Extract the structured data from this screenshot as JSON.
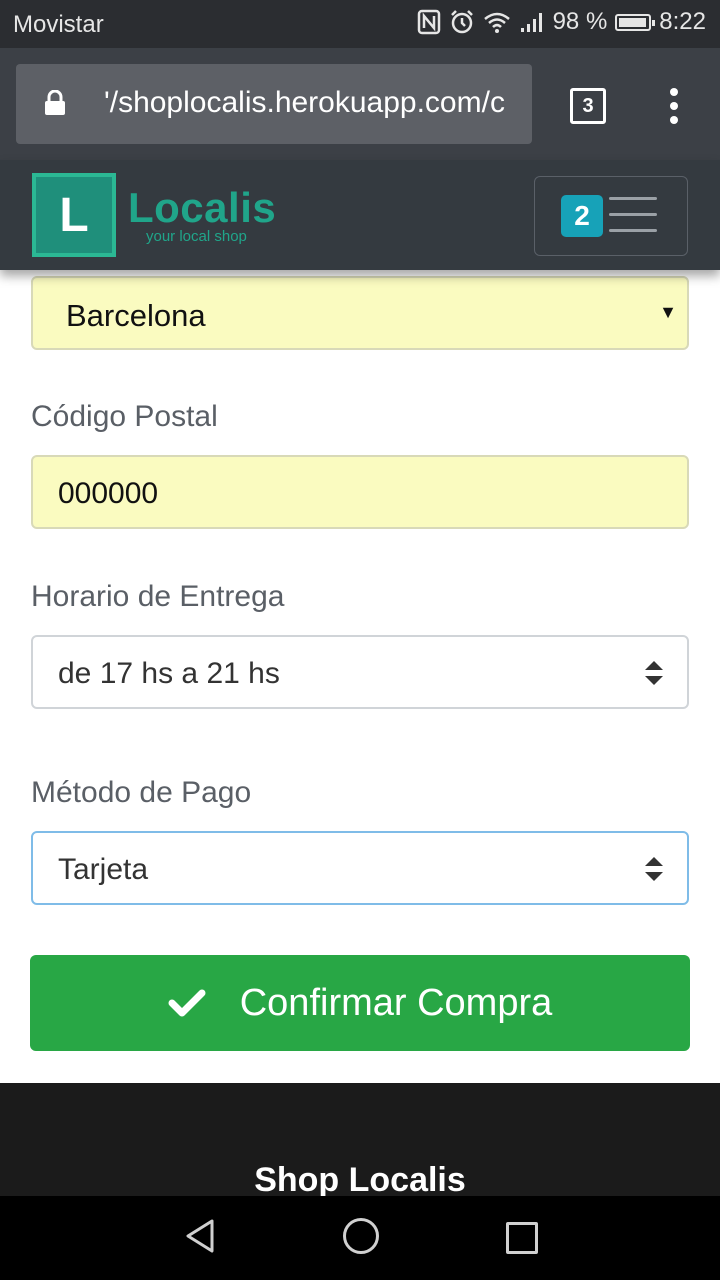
{
  "status_bar": {
    "carrier": "Movistar",
    "battery_text": "98 %",
    "time": "8:22",
    "battery_level": 0.98,
    "icons": [
      "nfc-icon",
      "alarm-icon",
      "wifi-icon",
      "signal-icon",
      "battery-icon"
    ]
  },
  "browser": {
    "url": "'/shoplocalis.herokuapp.com/c",
    "tab_count": "3"
  },
  "navbar": {
    "logo_letter": "L",
    "brand_name": "Localis",
    "tagline": "your local shop",
    "cart_count": "2"
  },
  "form": {
    "city_value": "Barcelona",
    "postal_label": "Código Postal",
    "postal_value": "000000",
    "schedule_label": "Horario de Entrega",
    "schedule_value": "de 17 hs a 21 hs",
    "payment_label": "Método de Pago",
    "payment_value": "Tarjeta",
    "confirm_label": "Confirmar Compra"
  },
  "footer": {
    "title": "Shop Localis"
  },
  "colors": {
    "confirm": "#28a745",
    "brand": "#20a58a",
    "badge": "#17a2b8",
    "filled_field": "#fafbc0"
  }
}
